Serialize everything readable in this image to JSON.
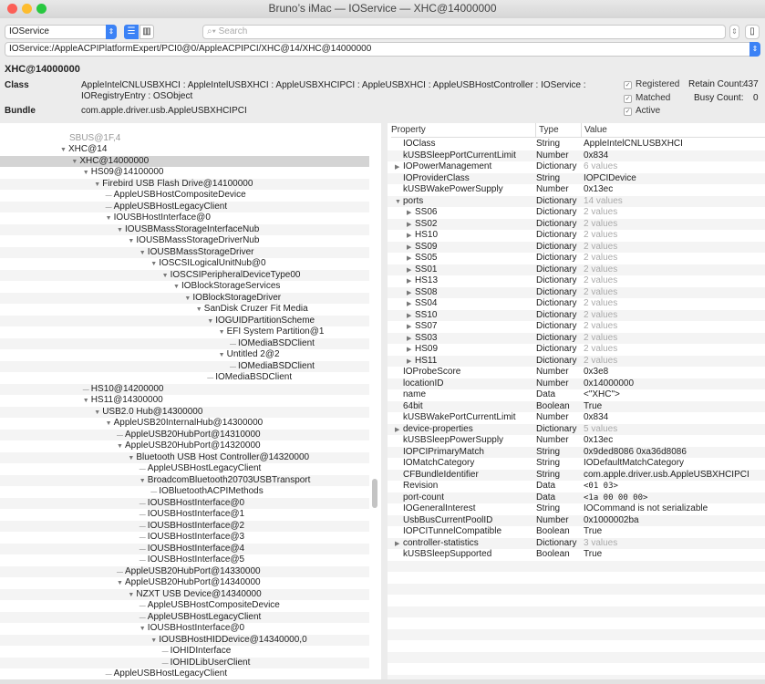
{
  "window": {
    "title": "Bruno’s iMac — IOService — XHC@14000000"
  },
  "toolbar": {
    "plane": "IOService",
    "search_placeholder": "Search",
    "path": "IOService:/AppleACPIPlatformExpert/PCI0@0/AppleACPIPCI/XHC@14/XHC@14000000"
  },
  "info": {
    "name": "XHC@14000000",
    "class_label": "Class",
    "class_value_1": "AppleIntelCNLUSBXHCI : AppleIntelUSBXHCI : AppleUSBXHCIPCI : AppleUSBXHCI : AppleUSBHostController : IOService :",
    "class_value_2": "IORegistryEntry : OSObject",
    "bundle_label": "Bundle",
    "bundle_value": "com.apple.driver.usb.AppleUSBXHCIPCI",
    "registered": "Registered",
    "matched": "Matched",
    "active": "Active",
    "retain_label": "Retain Count:",
    "retain_value": "437",
    "busy_label": "Busy Count:",
    "busy_value": "0"
  },
  "tree": {
    "partial_top": "SBUS@1F,4",
    "selected": "XHC@14000000",
    "items": [
      [
        "XHC@14",
        0,
        1
      ],
      [
        "XHC@14000000",
        1,
        1
      ],
      [
        "HS09@14100000",
        2,
        1
      ],
      [
        "Firebird USB Flash Drive@14100000",
        3,
        1
      ],
      [
        "AppleUSBHostCompositeDevice",
        4,
        0
      ],
      [
        "AppleUSBHostLegacyClient",
        4,
        0
      ],
      [
        "IOUSBHostInterface@0",
        4,
        1
      ],
      [
        "IOUSBMassStorageInterfaceNub",
        5,
        1
      ],
      [
        "IOUSBMassStorageDriverNub",
        6,
        1
      ],
      [
        "IOUSBMassStorageDriver",
        7,
        1
      ],
      [
        "IOSCSILogicalUnitNub@0",
        8,
        1
      ],
      [
        "IOSCSIPeripheralDeviceType00",
        9,
        1
      ],
      [
        "IOBlockStorageServices",
        10,
        1
      ],
      [
        "IOBlockStorageDriver",
        11,
        1
      ],
      [
        "SanDisk Cruzer Fit Media",
        12,
        1
      ],
      [
        "IOGUIDPartitionScheme",
        13,
        1
      ],
      [
        "EFI System Partition@1",
        14,
        1
      ],
      [
        "IOMediaBSDClient",
        15,
        0
      ],
      [
        "Untitled 2@2",
        14,
        1
      ],
      [
        "IOMediaBSDClient",
        15,
        0
      ],
      [
        "IOMediaBSDClient",
        13,
        0
      ],
      [
        "HS10@14200000",
        2,
        0
      ],
      [
        "HS11@14300000",
        2,
        1
      ],
      [
        "USB2.0 Hub@14300000",
        3,
        1
      ],
      [
        "AppleUSB20InternalHub@14300000",
        4,
        1
      ],
      [
        "AppleUSB20HubPort@14310000",
        5,
        0
      ],
      [
        "AppleUSB20HubPort@14320000",
        5,
        1
      ],
      [
        "Bluetooth USB Host Controller@14320000",
        6,
        1
      ],
      [
        "AppleUSBHostLegacyClient",
        7,
        0
      ],
      [
        "BroadcomBluetooth20703USBTransport",
        7,
        1
      ],
      [
        "IOBluetoothACPIMethods",
        8,
        0
      ],
      [
        "IOUSBHostInterface@0",
        7,
        0
      ],
      [
        "IOUSBHostInterface@1",
        7,
        0
      ],
      [
        "IOUSBHostInterface@2",
        7,
        0
      ],
      [
        "IOUSBHostInterface@3",
        7,
        0
      ],
      [
        "IOUSBHostInterface@4",
        7,
        0
      ],
      [
        "IOUSBHostInterface@5",
        7,
        0
      ],
      [
        "AppleUSB20HubPort@14330000",
        5,
        0
      ],
      [
        "AppleUSB20HubPort@14340000",
        5,
        1
      ],
      [
        "NZXT USB Device@14340000",
        6,
        1
      ],
      [
        "AppleUSBHostCompositeDevice",
        7,
        0
      ],
      [
        "AppleUSBHostLegacyClient",
        7,
        0
      ],
      [
        "IOUSBHostInterface@0",
        7,
        1
      ],
      [
        "IOUSBHostHIDDevice@14340000,0",
        8,
        1
      ],
      [
        "IOHIDInterface",
        9,
        0
      ],
      [
        "IOHIDLibUserClient",
        9,
        0
      ],
      [
        "AppleUSBHostLegacyClient",
        4,
        0
      ]
    ]
  },
  "properties": {
    "headers": [
      "Property",
      "Type",
      "Value"
    ],
    "rows": [
      [
        "IOClass",
        "String",
        "AppleIntelCNLUSBXHCI",
        0,
        ""
      ],
      [
        "kUSBSleepPortCurrentLimit",
        "Number",
        "0x834",
        0,
        ""
      ],
      [
        "IOPowerManagement",
        "Dictionary",
        "6 values",
        0,
        "collapsed"
      ],
      [
        "IOProviderClass",
        "String",
        "IOPCIDevice",
        0,
        ""
      ],
      [
        "kUSBWakePowerSupply",
        "Number",
        "0x13ec",
        0,
        ""
      ],
      [
        "ports",
        "Dictionary",
        "14 values",
        0,
        "expanded"
      ],
      [
        "SS06",
        "Dictionary",
        "2 values",
        1,
        "collapsed"
      ],
      [
        "SS02",
        "Dictionary",
        "2 values",
        1,
        "collapsed"
      ],
      [
        "HS10",
        "Dictionary",
        "2 values",
        1,
        "collapsed"
      ],
      [
        "SS09",
        "Dictionary",
        "2 values",
        1,
        "collapsed"
      ],
      [
        "SS05",
        "Dictionary",
        "2 values",
        1,
        "collapsed"
      ],
      [
        "SS01",
        "Dictionary",
        "2 values",
        1,
        "collapsed"
      ],
      [
        "HS13",
        "Dictionary",
        "2 values",
        1,
        "collapsed"
      ],
      [
        "SS08",
        "Dictionary",
        "2 values",
        1,
        "collapsed"
      ],
      [
        "SS04",
        "Dictionary",
        "2 values",
        1,
        "collapsed"
      ],
      [
        "SS10",
        "Dictionary",
        "2 values",
        1,
        "collapsed"
      ],
      [
        "SS07",
        "Dictionary",
        "2 values",
        1,
        "collapsed"
      ],
      [
        "SS03",
        "Dictionary",
        "2 values",
        1,
        "collapsed"
      ],
      [
        "HS09",
        "Dictionary",
        "2 values",
        1,
        "collapsed"
      ],
      [
        "HS11",
        "Dictionary",
        "2 values",
        1,
        "collapsed"
      ],
      [
        "IOProbeScore",
        "Number",
        "0x3e8",
        0,
        ""
      ],
      [
        "locationID",
        "Number",
        "0x14000000",
        0,
        ""
      ],
      [
        "name",
        "Data",
        "<\"XHC\">",
        0,
        ""
      ],
      [
        "64bit",
        "Boolean",
        "True",
        0,
        ""
      ],
      [
        "kUSBWakePortCurrentLimit",
        "Number",
        "0x834",
        0,
        ""
      ],
      [
        "device-properties",
        "Dictionary",
        "5 values",
        0,
        "collapsed"
      ],
      [
        "kUSBSleepPowerSupply",
        "Number",
        "0x13ec",
        0,
        ""
      ],
      [
        "IOPCIPrimaryMatch",
        "String",
        "0x9ded8086 0xa36d8086",
        0,
        ""
      ],
      [
        "IOMatchCategory",
        "String",
        "IODefaultMatchCategory",
        0,
        ""
      ],
      [
        "CFBundleIdentifier",
        "String",
        "com.apple.driver.usb.AppleUSBXHCIPCI",
        0,
        ""
      ],
      [
        "Revision",
        "Data",
        "<01 03>",
        0,
        "mono"
      ],
      [
        "port-count",
        "Data",
        "<1a 00 00 00>",
        0,
        "mono"
      ],
      [
        "IOGeneralInterest",
        "String",
        "IOCommand is not serializable",
        0,
        ""
      ],
      [
        "UsbBusCurrentPoolID",
        "Number",
        "0x1000002ba",
        0,
        ""
      ],
      [
        "IOPCITunnelCompatible",
        "Boolean",
        "True",
        0,
        ""
      ],
      [
        "controller-statistics",
        "Dictionary",
        "3 values",
        0,
        "collapsed"
      ],
      [
        "kUSBSleepSupported",
        "Boolean",
        "True",
        0,
        ""
      ]
    ]
  }
}
